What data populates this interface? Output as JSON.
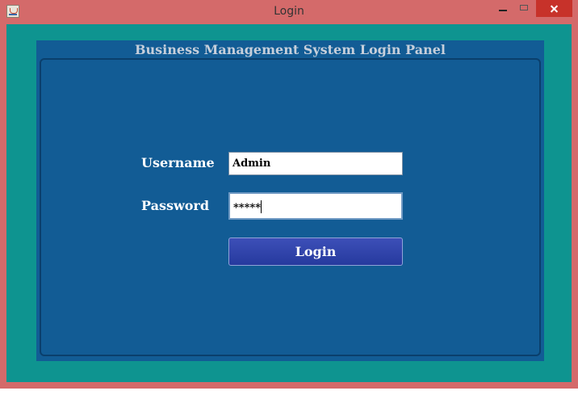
{
  "window": {
    "title": "Login"
  },
  "panel": {
    "title": "Business Management System Login Panel"
  },
  "form": {
    "username_label": "Username",
    "username_value": "Admin",
    "password_label": "Password",
    "password_value": "*****",
    "login_label": "Login"
  },
  "colors": {
    "window_frame": "#d46a6a",
    "content_bg": "#0e9490",
    "panel_bg": "#125c95",
    "button_bg": "#2e42a8",
    "close_button": "#c7322a"
  }
}
